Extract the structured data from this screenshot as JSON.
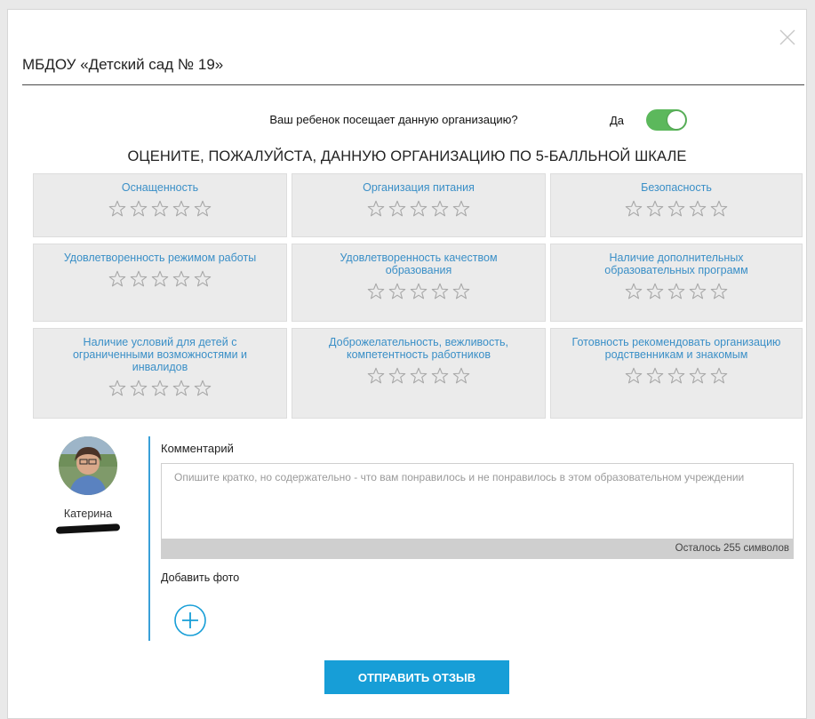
{
  "modal": {
    "title": "МБДОУ «Детский сад № 19»",
    "close_icon": "close-icon"
  },
  "attendance": {
    "question": "Ваш ребенок посещает данную организацию?",
    "answer_label": "Да",
    "toggle_on": true,
    "toggle_color": "#5cb85c"
  },
  "rating": {
    "heading": "ОЦЕНИТЕ, ПОЖАЛУЙСТА, ДАННУЮ ОРГАНИЗАЦИЮ ПО 5-БАЛЛЬНОЙ ШКАЛЕ",
    "max_stars": 5,
    "criteria": [
      {
        "label": "Оснащенность",
        "stars": 0
      },
      {
        "label": "Организация питания",
        "stars": 0
      },
      {
        "label": "Безопасность",
        "stars": 0
      },
      {
        "label": "Удовлетворенность режимом работы",
        "stars": 0
      },
      {
        "label": "Удовлетворенность качеством образования",
        "stars": 0
      },
      {
        "label": "Наличие дополнительных образовательных программ",
        "stars": 0
      },
      {
        "label": "Наличие условий для детей с ограниченными возможностями и инвалидов",
        "stars": 0
      },
      {
        "label": "Доброжелательность, вежливость, компетентность работников",
        "stars": 0
      },
      {
        "label": "Готовность рекомендовать организацию родственникам и знакомым",
        "stars": 0
      }
    ],
    "label_color": "#3a8fc7"
  },
  "user": {
    "name": "Катерина",
    "avatar_icon": "avatar"
  },
  "comment": {
    "label": "Комментарий",
    "value": "",
    "placeholder": "Опишите кратко, но содержательно - что вам понравилось и не понравилось в этом образовательном учреждении",
    "remaining": "Осталось 255 символов"
  },
  "photo": {
    "label": "Добавить фото",
    "icon": "plus-circle-icon"
  },
  "submit": {
    "label": "ОТПРАВИТЬ ОТЗЫВ",
    "color": "#179ed7"
  }
}
